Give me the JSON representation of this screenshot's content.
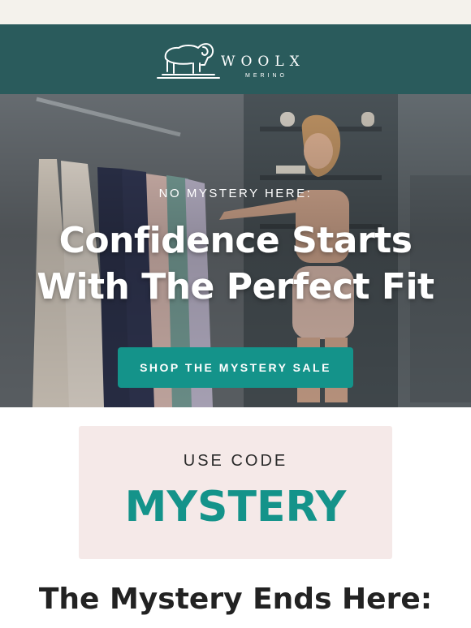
{
  "colors": {
    "header_bg": "#2a5b5c",
    "accent_teal": "#14938a",
    "code_card_bg": "#f5e9e8",
    "top_strip": "#f4f2ec"
  },
  "brand": {
    "logo_icon": "ram-icon",
    "name": "WOOLX",
    "sub": "MERINO"
  },
  "hero": {
    "eyebrow": "NO MYSTERY HERE:",
    "headline_line1": "Confidence Starts",
    "headline_line2": "With The Perfect Fit",
    "cta_label": "SHOP THE MYSTERY SALE"
  },
  "promo": {
    "label": "USE CODE",
    "code": "MYSTERY"
  },
  "section": {
    "heading": "The Mystery Ends Here:"
  }
}
